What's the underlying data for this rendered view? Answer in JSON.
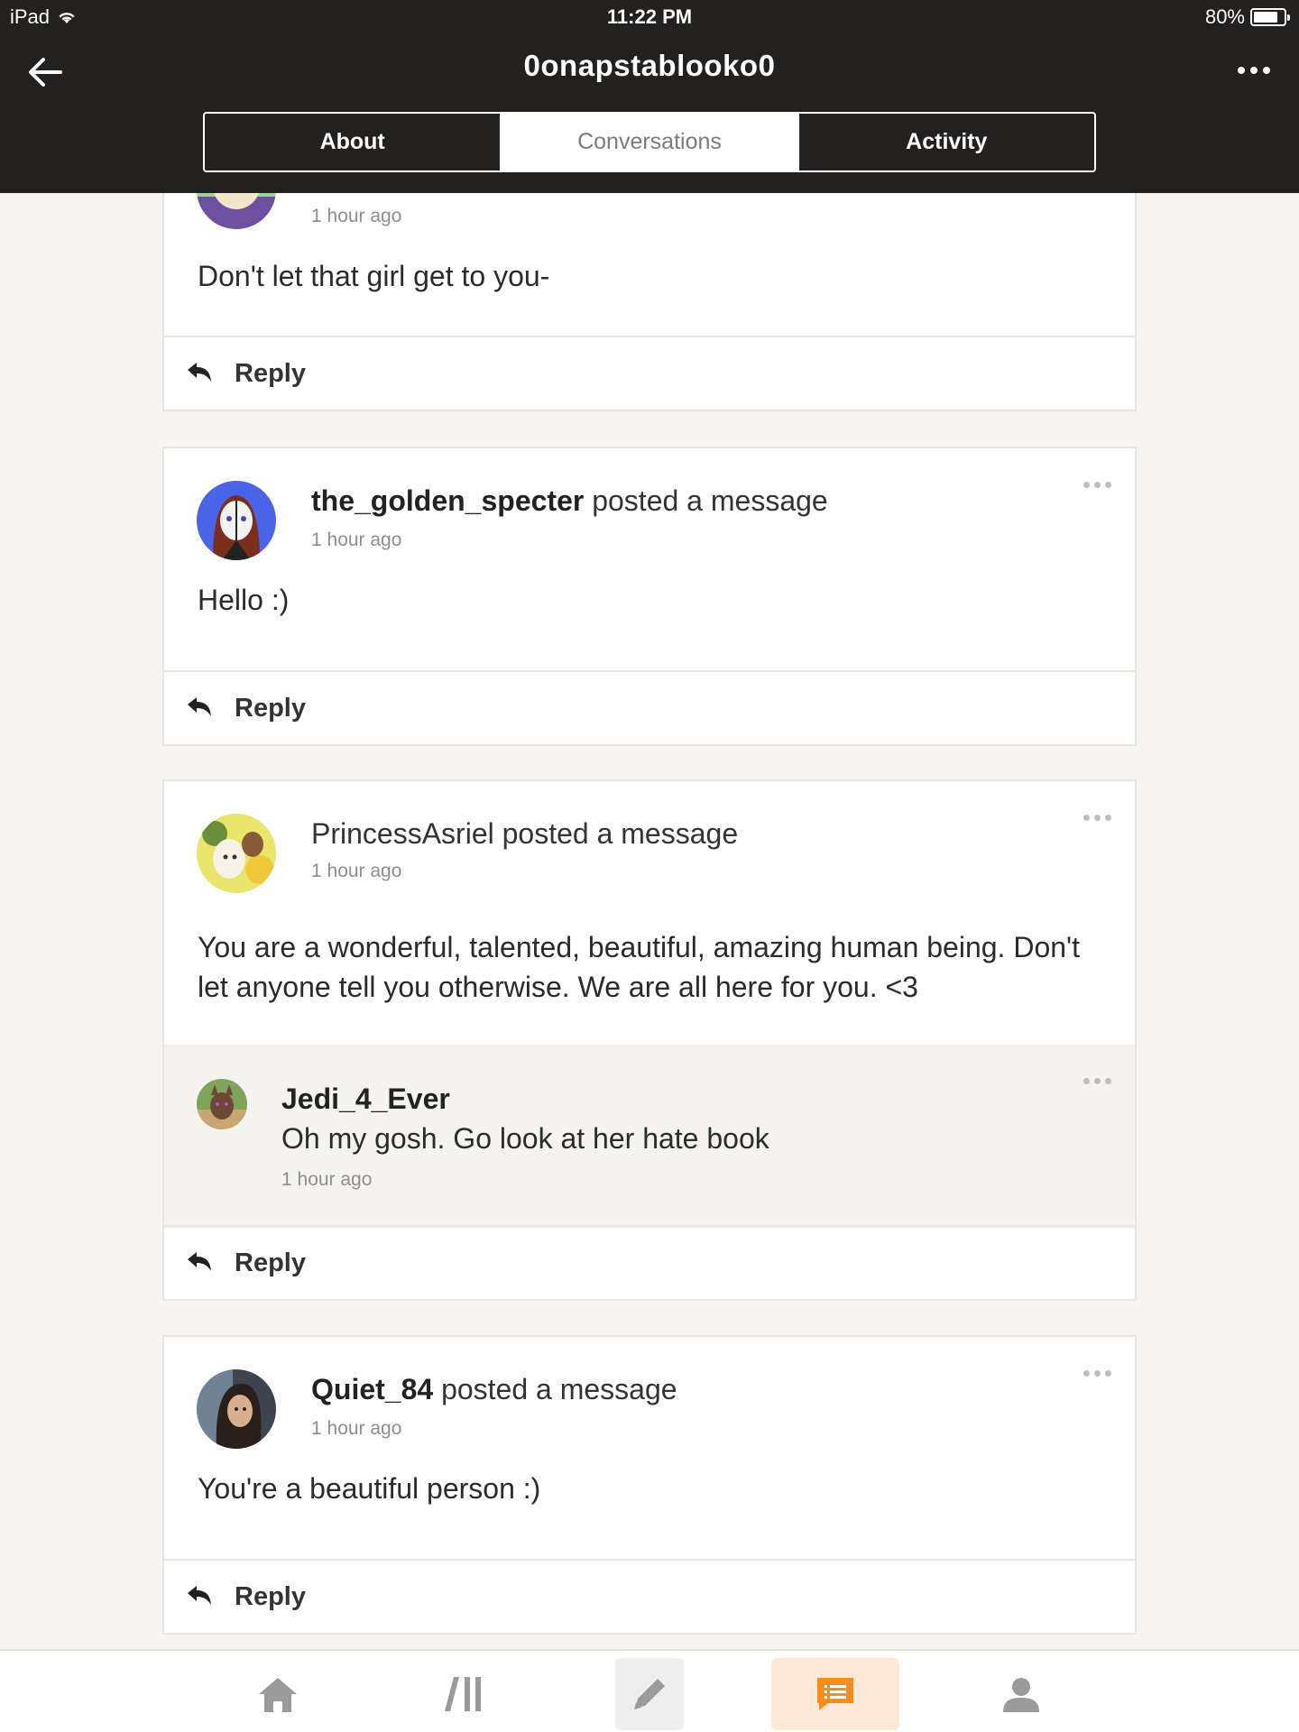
{
  "status_bar": {
    "device": "iPad",
    "time": "11:22 PM",
    "battery": "80%",
    "battery_level": 0.8
  },
  "nav": {
    "title": "0onapstablooko0"
  },
  "tabs": [
    {
      "label": "About",
      "active": false
    },
    {
      "label": "Conversations",
      "active": true
    },
    {
      "label": "Activity",
      "active": false
    }
  ],
  "posts": [
    {
      "time": "1 hour ago",
      "message": "Don't let that girl get to you-",
      "reply_label": "Reply"
    },
    {
      "author": "the_golden_specter",
      "action": "posted a message",
      "time": "1 hour ago",
      "message": "Hello :)",
      "reply_label": "Reply"
    },
    {
      "author": "PrincessAsriel",
      "action": "posted a message",
      "time": "1 hour ago",
      "message": "You are a wonderful, talented, beautiful, amazing human being. Don't let anyone tell you otherwise. We are all here for you. <3",
      "comment": {
        "author": "Jedi_4_Ever",
        "text": "Oh my gosh. Go look at her hate book",
        "time": "1 hour ago"
      },
      "reply_label": "Reply"
    },
    {
      "author": "Quiet_84",
      "action": "posted a message",
      "time": "1 hour ago",
      "message": "You're a beautiful person :)",
      "reply_label": "Reply"
    }
  ],
  "bottom_nav": [
    {
      "icon": "home-icon",
      "active": false
    },
    {
      "icon": "library-icon",
      "active": false
    },
    {
      "icon": "pencil-icon",
      "active": false
    },
    {
      "icon": "conversation-icon",
      "active": true
    },
    {
      "icon": "profile-icon",
      "active": false
    }
  ],
  "colors": {
    "header_bg": "#222120",
    "page_bg": "#f6f5f2",
    "accent": "#ff8c1a",
    "accent_bg": "#fde9d6"
  }
}
